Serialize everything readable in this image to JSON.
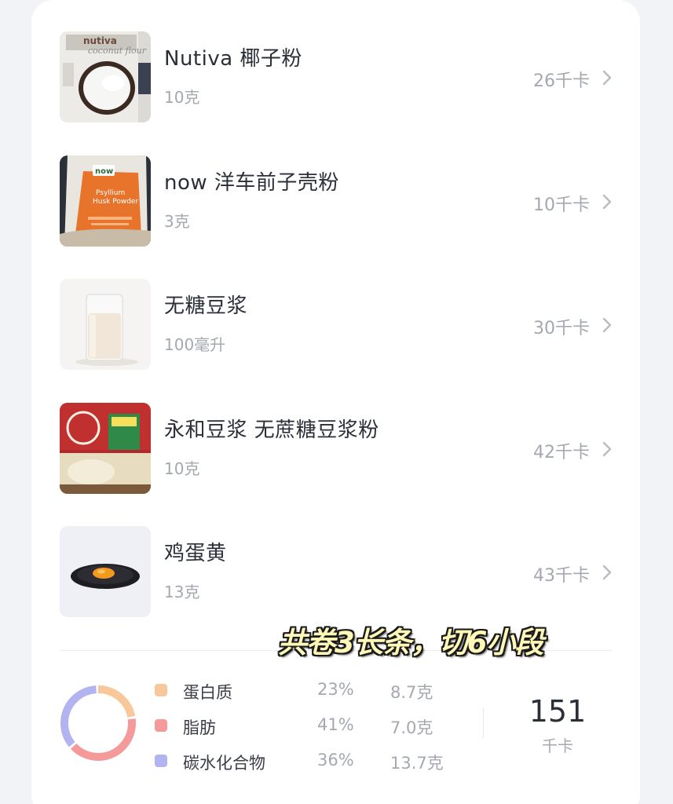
{
  "foods": [
    {
      "name": "Nutiva 椰子粉",
      "amount": "10克",
      "kcal": "26千卡",
      "image": "coconut-flour-package"
    },
    {
      "name": "now 洋车前子壳粉",
      "amount": "3克",
      "kcal": "10千卡",
      "image": "psyllium-husk-powder-package"
    },
    {
      "name": "无糖豆浆",
      "amount": "100毫升",
      "kcal": "30千卡",
      "image": "soy-milk-glass"
    },
    {
      "name": "永和豆浆 无蔗糖豆浆粉",
      "amount": "10克",
      "kcal": "42千卡",
      "image": "soy-milk-powder-package"
    },
    {
      "name": "鸡蛋黄",
      "amount": "13克",
      "kcal": "43千卡",
      "image": "egg-yolk-plate"
    }
  ],
  "macros": [
    {
      "name": "蛋白质",
      "percent": "23%",
      "grams": "8.7克",
      "color": "#f9c89a",
      "share": 0.23
    },
    {
      "name": "脂肪",
      "percent": "41%",
      "grams": "7.0克",
      "color": "#f49a9a",
      "share": 0.41
    },
    {
      "name": "碳水化合物",
      "percent": "36%",
      "grams": "13.7克",
      "color": "#b3b3f2",
      "share": 0.36
    }
  ],
  "total": {
    "value": "151",
    "unit": "千卡"
  },
  "overlay_caption": "共卷3长条，切6小段",
  "colors": {
    "text_primary": "#2b2f38",
    "text_secondary": "#a4a8b0",
    "card_bg": "#ffffff"
  }
}
